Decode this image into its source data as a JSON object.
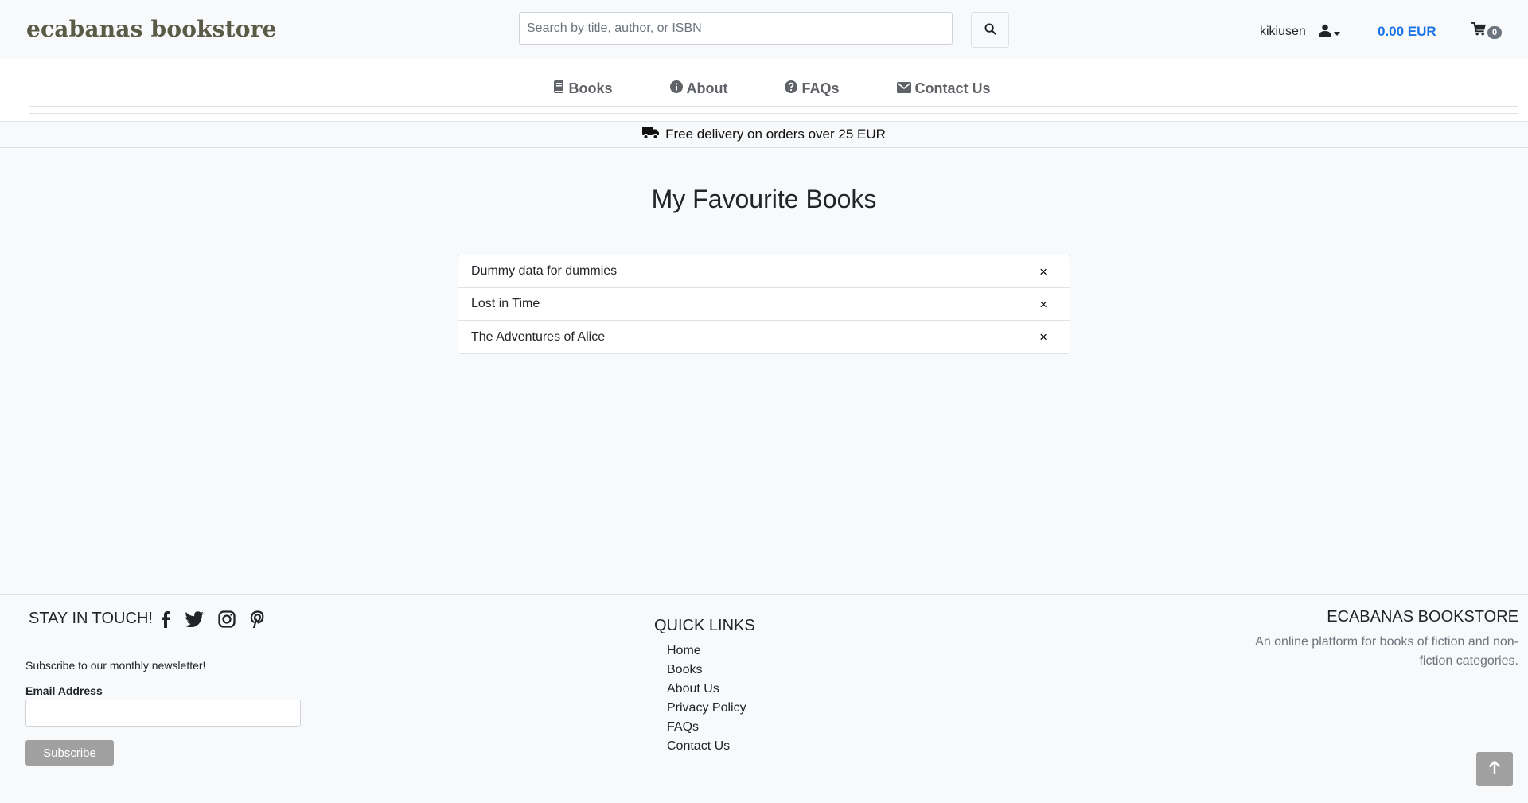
{
  "header": {
    "brand": "ecabanas bookstore",
    "search_placeholder": "Search by title, author, or ISBN",
    "username": "kikiusen",
    "cart_total": "0.00 EUR",
    "cart_count": "0"
  },
  "nav": {
    "items": [
      {
        "label": "Books",
        "icon": "book-icon"
      },
      {
        "label": "About",
        "icon": "info-icon"
      },
      {
        "label": "FAQs",
        "icon": "question-icon"
      },
      {
        "label": "Contact Us",
        "icon": "envelope-icon"
      }
    ]
  },
  "banner": {
    "text": "Free delivery on orders over 25 EUR",
    "icon": "truck-icon"
  },
  "main": {
    "title": "My Favourite Books",
    "favourites": [
      {
        "title": "Dummy data for dummies",
        "remove": "×"
      },
      {
        "title": "Lost in Time",
        "remove": "×"
      },
      {
        "title": "The Adventures of Alice",
        "remove": "×"
      }
    ]
  },
  "footer": {
    "stay_title": "STAY IN TOUCH!",
    "social": [
      "facebook-icon",
      "twitter-icon",
      "instagram-icon",
      "pinterest-icon"
    ],
    "newsletter_text": "Subscribe to our monthly newsletter!",
    "email_label": "Email Address",
    "email_value": "",
    "subscribe_label": "Subscribe",
    "quick_links_title": "QUICK LINKS",
    "quick_links": [
      "Home",
      "Books",
      "About Us",
      "Privacy Policy",
      "FAQs",
      "Contact Us"
    ],
    "about_title": "ECABANAS BOOKSTORE",
    "about_text": "An online platform for books of fiction and non-fiction categories."
  },
  "colors": {
    "accent": "#1a73e8",
    "brand": "#5a5a46",
    "nav_text": "#5f6368",
    "button_gray": "#a0a0a0"
  }
}
